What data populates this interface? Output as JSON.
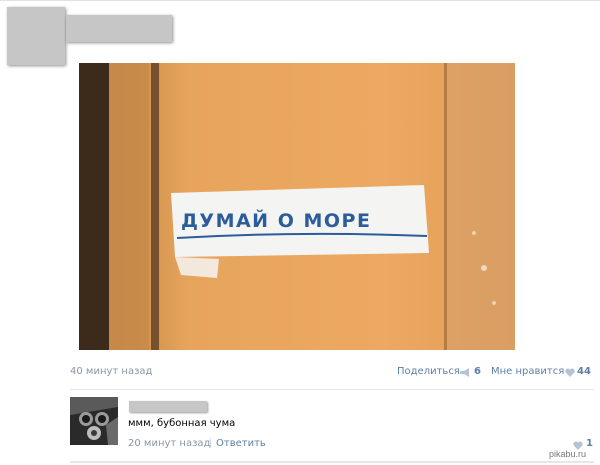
{
  "post": {
    "photo": {
      "stencil_text": "ДУМАЙ О МОРЕ",
      "colors": {
        "wall": "#e9a55a",
        "paint": "#f4f4f2",
        "ink": "#2b5c9c"
      }
    },
    "timestamp": "40 минут назад",
    "share_label": "Поделиться",
    "share_count": "6",
    "likes_label": "Мне нравится",
    "likes_count": "44"
  },
  "comment": {
    "text": "ммм, бубонная чума",
    "timestamp": "20 минут назад",
    "separator": "|",
    "reply_label": "Ответить",
    "likes_count": "1"
  },
  "watermark": "pikabu.ru",
  "colors": {
    "link": "#5e7fa6",
    "muted": "#8b96a3",
    "censor": "#c6c6c6"
  }
}
